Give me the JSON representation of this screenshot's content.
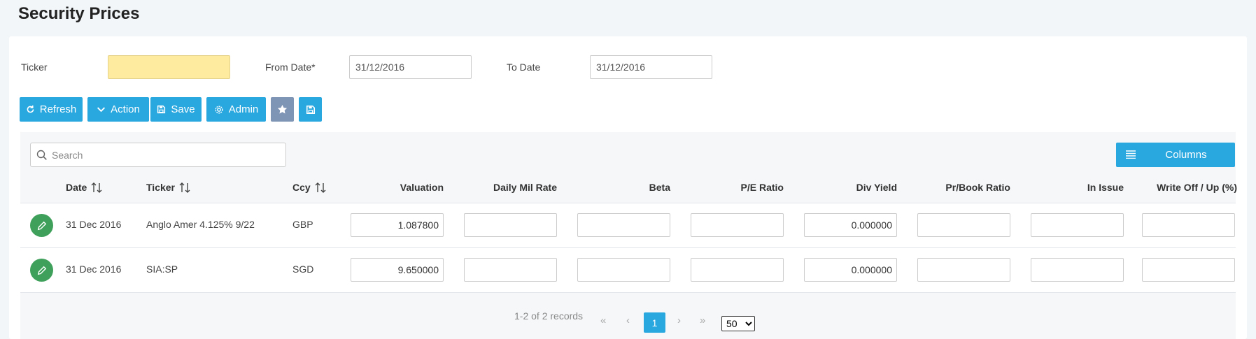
{
  "page": {
    "title": "Security Prices"
  },
  "filters": {
    "ticker_label": "Ticker",
    "ticker_value": "",
    "from_label": "From Date*",
    "from_value": "31/12/2016",
    "to_label": "To Date",
    "to_value": "31/12/2016"
  },
  "toolbar": {
    "refresh": "Refresh",
    "action": "Action",
    "save": "Save",
    "admin": "Admin",
    "favorite_icon": "star-icon",
    "save_layout_icon": "floppy-disk-icon"
  },
  "grid": {
    "search_placeholder": "Search",
    "columns_button": "Columns",
    "columns": {
      "date": "Date",
      "ticker": "Ticker",
      "ccy": "Ccy",
      "valuation": "Valuation",
      "daily_mil_rate": "Daily Mil Rate",
      "beta": "Beta",
      "pe_ratio": "P/E Ratio",
      "div_yield": "Div Yield",
      "pr_book_ratio": "Pr/Book Ratio",
      "in_issue": "In Issue",
      "write_off": "Write Off / Up (%)"
    },
    "rows": [
      {
        "date": "31 Dec 2016",
        "ticker": "Anglo Amer 4.125% 9/22",
        "ccy": "GBP",
        "valuation": "1.087800",
        "daily_mil_rate": "",
        "beta": "",
        "pe_ratio": "",
        "div_yield": "0.000000",
        "pr_book_ratio": "",
        "in_issue": "",
        "write_off": ""
      },
      {
        "date": "31 Dec 2016",
        "ticker": "SIA:SP",
        "ccy": "SGD",
        "valuation": "9.650000",
        "daily_mil_rate": "",
        "beta": "",
        "pe_ratio": "",
        "div_yield": "0.000000",
        "pr_book_ratio": "",
        "in_issue": "",
        "write_off": ""
      }
    ]
  },
  "pagination": {
    "summary": "1-2 of 2 records",
    "current_page": "1",
    "page_size": "50",
    "page_size_options": [
      "50"
    ]
  },
  "colors": {
    "accent": "#29a7df",
    "edit_button": "#3ea05a",
    "ticker_highlight": "#ffeba0",
    "neutral_button": "#7f95b5"
  }
}
